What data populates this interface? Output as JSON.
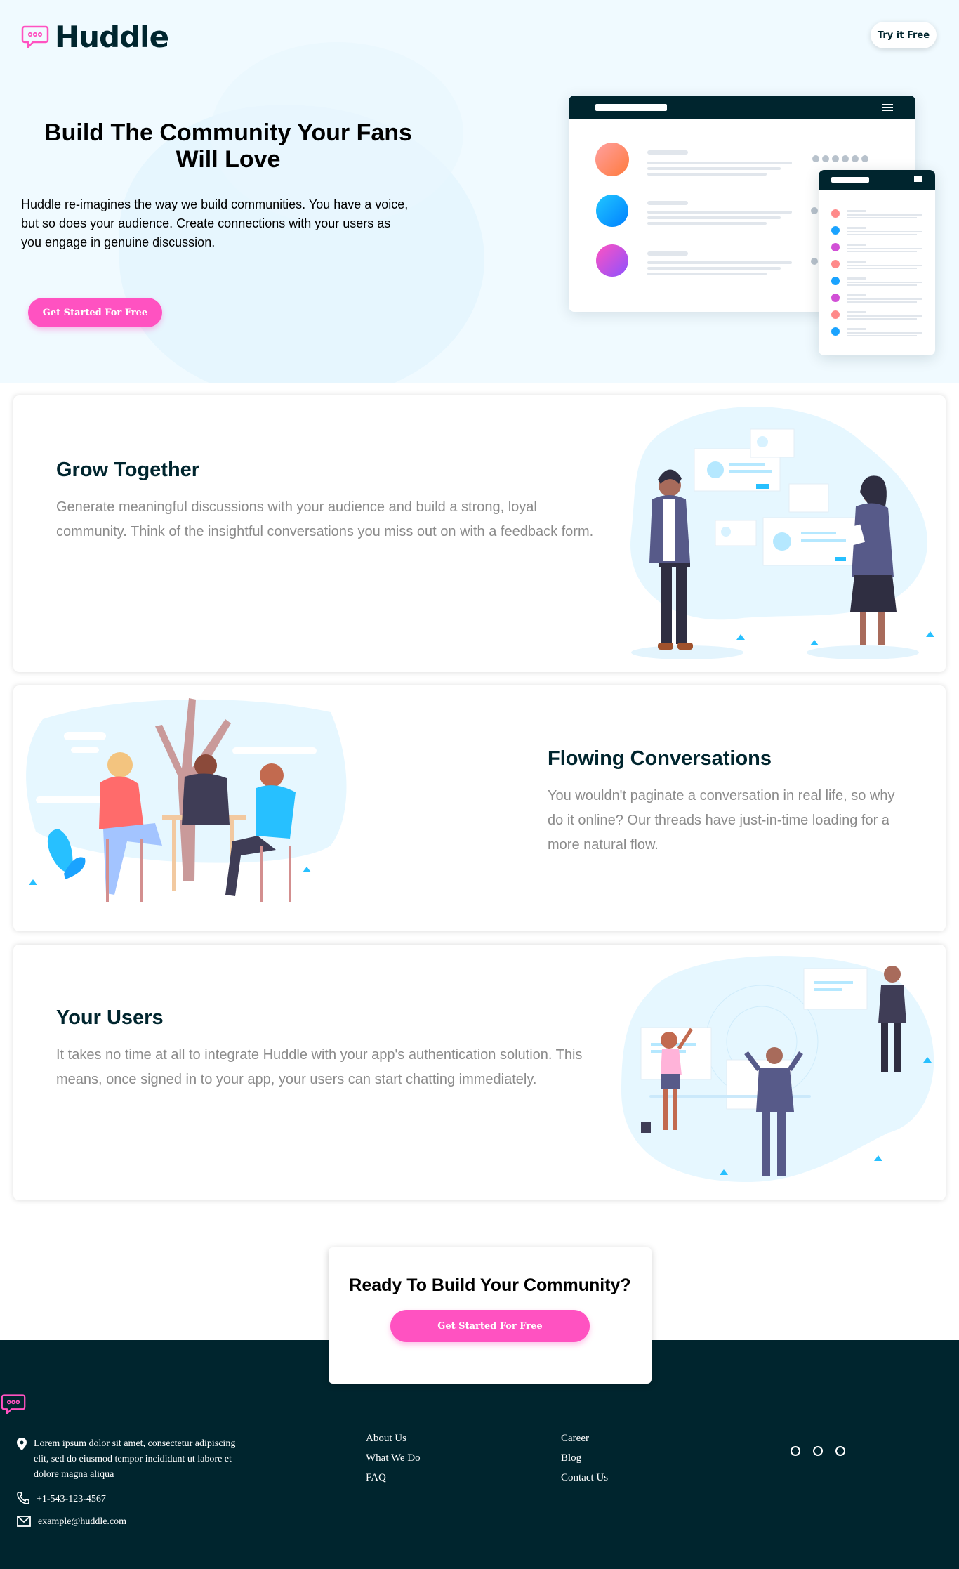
{
  "header": {
    "brand": "Huddle",
    "try_button": "Try it Free"
  },
  "hero": {
    "title": "Build The Community Your Fans Will Love",
    "description": "Huddle re-imagines the way we build communities. You have a voice, but so does your audience. Create connections with your users as you engage in genuine discussion.",
    "cta": "Get Started For Free"
  },
  "features": [
    {
      "title": "Grow Together",
      "text": "Generate meaningful discussions with your audience and build a strong, loyal community. Think of the insightful conversations you miss out on with a feedback form."
    },
    {
      "title": "Flowing Conversations",
      "text": "You wouldn't paginate a conversation in real life, so why do it online? Our threads have just-in-time loading for a more natural flow."
    },
    {
      "title": "Your Users",
      "text": "It takes no time at all to integrate Huddle with your app's authentication solution. This means, once signed in to your app, your users can start chatting immediately."
    }
  ],
  "cta_box": {
    "title": "Ready To Build Your Community?",
    "button": "Get Started For Free"
  },
  "footer": {
    "address": "Lorem ipsum dolor sit amet, consectetur adipiscing elit, sed do eiusmod tempor incididunt ut labore et dolore magna aliqua",
    "phone": "+1-543-123-4567",
    "email": "example@huddle.com",
    "links_col1": [
      "About Us",
      "What We Do",
      "FAQ"
    ],
    "links_col2": [
      "Career",
      "Blog",
      "Contact Us"
    ],
    "social_icons": [
      "social-circle-icon",
      "social-circle-icon",
      "social-circle-icon"
    ]
  },
  "colors": {
    "brand_pink": "#ff52c1",
    "dark_cyan": "#00252e",
    "hero_bg": "#f0faff"
  }
}
